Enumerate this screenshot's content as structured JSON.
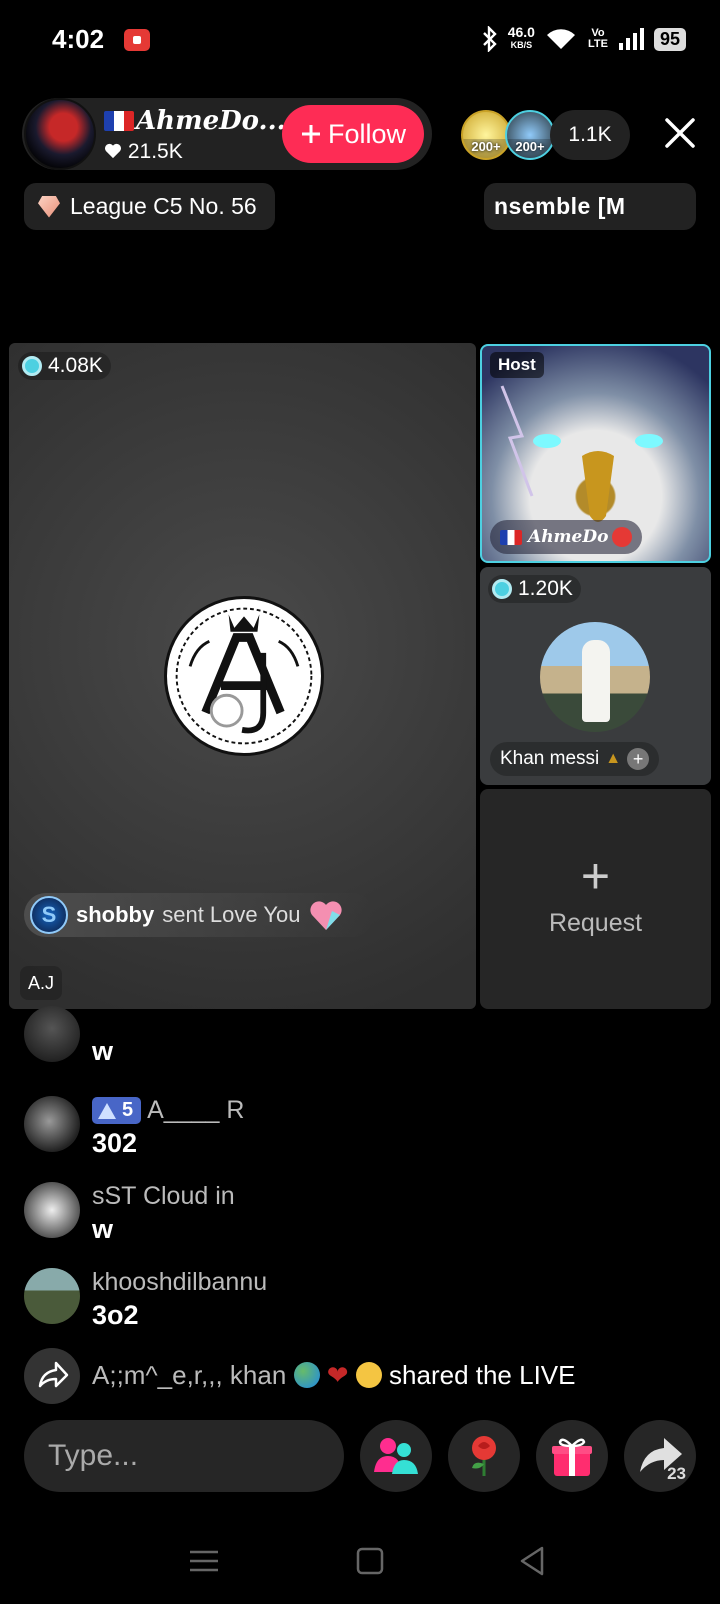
{
  "status_bar": {
    "time": "4:02",
    "net_speed": "46.0",
    "net_unit": "KB/S",
    "volte": "Vo LTE",
    "battery": "95"
  },
  "host": {
    "name": "AhmeDo...",
    "likes": "21.5K",
    "follow_label": "Follow"
  },
  "viewers": {
    "badges": [
      "200+",
      "200+"
    ],
    "count": "1.1K"
  },
  "league_label": "League C5 No. 56",
  "ensemble_label": "nsemble   [M",
  "main_tile": {
    "gem_count": "4.08K",
    "gift_user": "shobby",
    "gift_action": "sent Love You",
    "label": "A.J"
  },
  "host_tile": {
    "badge": "Host",
    "name": "AhmeDo"
  },
  "guest_tile": {
    "gem_count": "1.20K",
    "name": "Khan messi"
  },
  "request_tile": {
    "label": "Request"
  },
  "comments": [
    {
      "name": "",
      "text": "w"
    },
    {
      "level": "5",
      "name": "A____ R",
      "text": "302"
    },
    {
      "name": "sST Cloud in",
      "text": "w"
    },
    {
      "name": "khooshdilbannu",
      "text": "3o2"
    }
  ],
  "share_event": {
    "user": "A;;m^_e,r,,, khan",
    "action": "shared the LIVE"
  },
  "input": {
    "placeholder": "Type..."
  },
  "share_count": "23",
  "colors": {
    "follow": "#fe2c55",
    "host_border": "#4dd0e1",
    "level_badge": "#4866c7"
  }
}
